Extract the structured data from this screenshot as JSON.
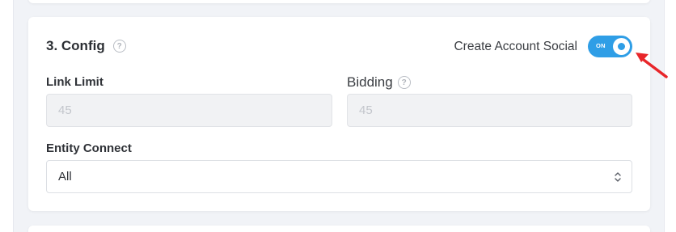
{
  "section": {
    "title": "3. Config",
    "help_icon": "question-circle-icon"
  },
  "toggle": {
    "label": "Create Account Social",
    "state_text": "ON",
    "checked": true,
    "accent": "#2f9ee6"
  },
  "fields": {
    "link_limit": {
      "label": "Link Limit",
      "value": "45"
    },
    "bidding": {
      "label": "Bidding",
      "value": "45",
      "help_icon": "question-circle-icon"
    },
    "entity_connect": {
      "label": "Entity Connect",
      "selected": "All",
      "chevron_icon": "chevron-up-down-icon"
    }
  },
  "annotation": {
    "arrow_color": "#e8262a",
    "icon": "red-arrow-icon"
  }
}
